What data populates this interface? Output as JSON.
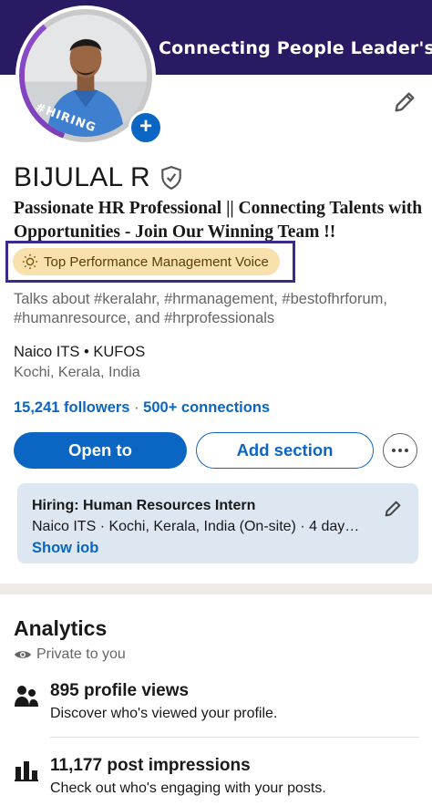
{
  "banner": {
    "text": "Connecting People Leader's ..."
  },
  "profile": {
    "hiring_tag": "#HIRING",
    "name": "BIJULAL R",
    "headline": "Passionate HR Professional || Connecting Talents with Opportunities - Join Our Winning Team !!",
    "voice_badge": "Top Performance Management Voice",
    "talks_about": "Talks about #keralahr, #hrmanagement, #bestofhrforum, #humanresource, and #hrprofessionals",
    "organization": "Naico ITS • KUFOS",
    "location": "Kochi, Kerala, India",
    "followers": "15,241 followers",
    "separator": "·",
    "connections": "500+ connections"
  },
  "actions": {
    "open_to": "Open to",
    "add_section": "Add section"
  },
  "hiring_card": {
    "title": "Hiring: Human Resources Intern",
    "detail": "Naico ITS · Kochi, Kerala, India (On-site) · 4 day…",
    "link": "Show iob"
  },
  "analytics": {
    "title": "Analytics",
    "visibility": "Private to you",
    "stats": [
      {
        "title": "895 profile views",
        "subtitle": "Discover who's viewed your profile.",
        "icon": "people-icon"
      },
      {
        "title": "11,177 post impressions",
        "subtitle": "Check out who's engaging with your posts.",
        "icon": "bar-chart-icon"
      }
    ]
  },
  "colors": {
    "banner": "#2a1a63",
    "brand_blue": "#0a66c2",
    "voice_badge_bg": "#f8e1ad",
    "voice_highlight_border": "#3b2a8c",
    "hiring_card_bg": "#dde7f1"
  }
}
